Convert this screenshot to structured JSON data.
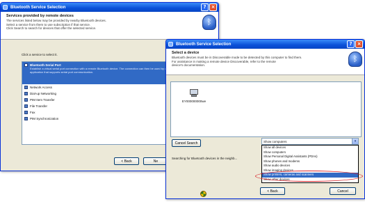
{
  "back_window": {
    "title": "Bluetooth Service Selection",
    "header_title": "Services provided by remote devices",
    "header_desc": [
      "The services listed below may be provided by nearby Bluetooth devices.",
      "Select a service from them to use subscription if that service.",
      "Click Search to search for devices that offer the selected service."
    ],
    "prompt": "Click a service to select it.",
    "selected_service": {
      "label": "Bluetooth Serial Port",
      "desc": "Establish a virtual serial port connection with a remote Bluetooth device. The connection can then be used by any application that supports serial port communication."
    },
    "services": [
      "Network Access",
      "Dial-up Networking",
      "PIM Item Transfer",
      "File Transfer",
      "Fax",
      "PIM Synchronization"
    ],
    "back_button": "< Back",
    "next_button_partial": "Ne"
  },
  "front_window": {
    "title": "Bluetooth Service Selection",
    "header_title": "Select a device",
    "header_desc": [
      "Bluetooth devices must be in Discoverable mode to be detected by this computer to find them.",
      "For assistance in making a remote device Discoverable, refer to the remote",
      "device's documentation."
    ],
    "device_label": "EY000000000we",
    "cancel_search_button": "Cancel Search",
    "status_text": "Searching for Bluetooth devices in the neighb...",
    "filter_selected": "Show computers",
    "filter_options": [
      "Show all devices",
      "Show computers",
      "Show Personal Digital Assistants (PDAs)",
      "Show phones and modems",
      "Show audio devices",
      "Show imaging devices",
      "Show printers, cameras and scanners",
      "Show other devices"
    ],
    "back_button": "< Back",
    "cancel_button": "Cancel"
  },
  "colors": {
    "titlebar": "#0a50d8",
    "selection": "#316ac5",
    "highlight_ring": "#d8262b"
  }
}
